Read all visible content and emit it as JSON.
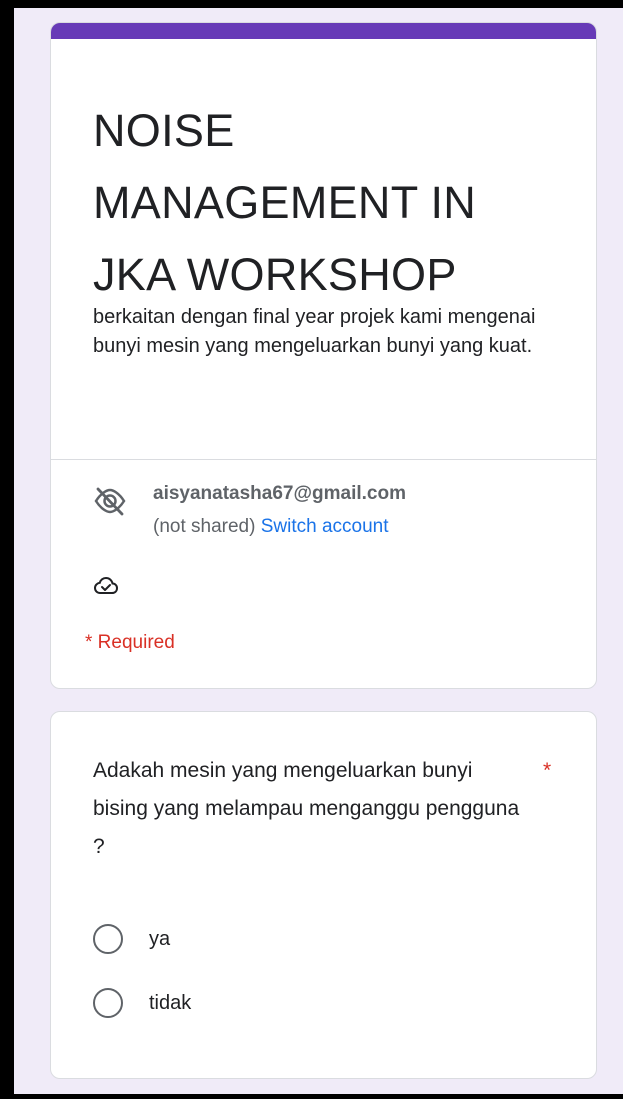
{
  "form": {
    "accent_color": "#673ab7",
    "title": "NOISE MANAGEMENT IN JKA WORKSHOP",
    "description": "berkaitan dengan final year projek kami mengenai bunyi mesin yang mengeluarkan bunyi yang kuat."
  },
  "account": {
    "email": "aisyanatasha67@gmail.com",
    "not_shared": "(not shared)",
    "switch_label": "Switch account",
    "visibility_icon": "eye-off-icon",
    "saved_icon": "cloud-check-icon"
  },
  "required_note": "* Required",
  "question": {
    "text": "Adakah mesin yang mengeluarkan bunyi bising yang melampau menganggu pengguna ?",
    "required_marker": "*",
    "options": [
      {
        "label": "ya"
      },
      {
        "label": "tidak"
      }
    ]
  },
  "colors": {
    "background": "#f0ebf8",
    "link": "#1a73e8",
    "required": "#d93025"
  }
}
